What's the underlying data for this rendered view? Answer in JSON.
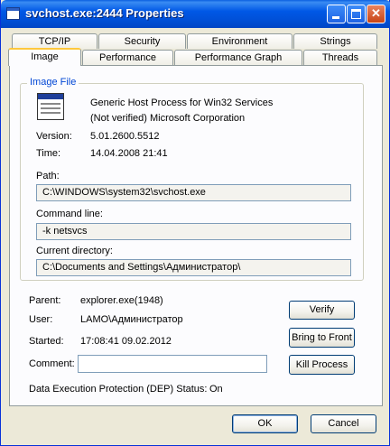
{
  "window": {
    "title": "svchost.exe:2444 Properties"
  },
  "tabs_row1": [
    "TCP/IP",
    "Security",
    "Environment",
    "Strings"
  ],
  "tabs_row2": [
    "Image",
    "Performance",
    "Performance Graph",
    "Threads"
  ],
  "image_file": {
    "legend": "Image File",
    "description": "Generic Host Process for Win32 Services",
    "company": "(Not verified) Microsoft Corporation",
    "version_label": "Version:",
    "version": "5.01.2600.5512",
    "time_label": "Time:",
    "time": "14.04.2008 21:41",
    "path_label": "Path:",
    "path": "C:\\WINDOWS\\system32\\svchost.exe",
    "cmdline_label": "Command line:",
    "cmdline": "-k netsvcs",
    "curdir_label": "Current directory:",
    "curdir": "C:\\Documents and Settings\\Администратор\\"
  },
  "process": {
    "parent_label": "Parent:",
    "parent": "explorer.exe(1948)",
    "user_label": "User:",
    "user": "LAMO\\Администратор",
    "started_label": "Started:",
    "started": "17:08:41   09.02.2012",
    "comment_label": "Comment:",
    "comment": "",
    "dep_label": "Data Execution Protection (DEP) Status:",
    "dep": "On"
  },
  "buttons": {
    "verify": "Verify",
    "bring_to_front": "Bring to Front",
    "kill_process": "Kill Process",
    "ok": "OK",
    "cancel": "Cancel"
  },
  "title_buttons": {
    "minimize": "_",
    "maximize": "□",
    "close": "✕"
  }
}
